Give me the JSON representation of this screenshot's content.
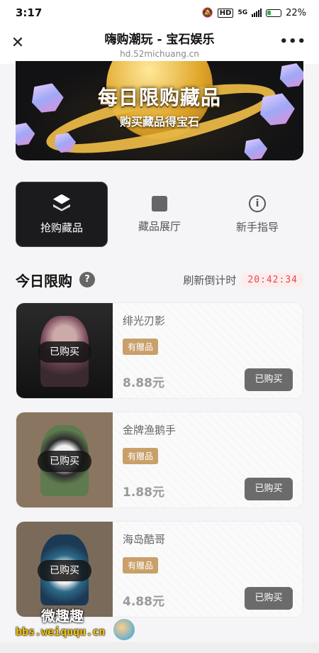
{
  "status_bar": {
    "time": "3:17",
    "network": "5G",
    "hd": "HD",
    "battery": "22%"
  },
  "header": {
    "title": "嗨购潮玩 - 宝石娱乐",
    "url": "hd.52michuang.cn"
  },
  "banner": {
    "title": "每日限购藏品",
    "subtitle": "购买藏品得宝石"
  },
  "nav": {
    "items": [
      {
        "label": "抢购藏品",
        "icon": "stack-icon",
        "active": true
      },
      {
        "label": "藏品展厅",
        "icon": "gallery-icon",
        "active": false
      },
      {
        "label": "新手指导",
        "icon": "info-icon",
        "active": false
      }
    ]
  },
  "today": {
    "heading": "今日限购",
    "help_icon": "?",
    "countdown_label": "刷新倒计时",
    "countdown": "20:42:34"
  },
  "products": [
    {
      "name": "绯光刃影",
      "gift": "有赠品",
      "price": "8.88元",
      "status": "已购买",
      "button": "已购买"
    },
    {
      "name": "金牌渔鹅手",
      "gift": "有赠品",
      "price": "1.88元",
      "status": "已购买",
      "button": "已购买"
    },
    {
      "name": "海岛酷哥",
      "gift": "有赠品",
      "price": "4.88元",
      "status": "已购买",
      "button": "已购买"
    }
  ],
  "watermark": {
    "line1": "微趣趣",
    "line2": "bbs.weiququ.cn"
  },
  "colors": {
    "accent_dark": "#1b1b1d",
    "gift_badge": "#c9a06a",
    "countdown_text": "#e24b4b",
    "button_disabled": "#6b6b6b"
  }
}
